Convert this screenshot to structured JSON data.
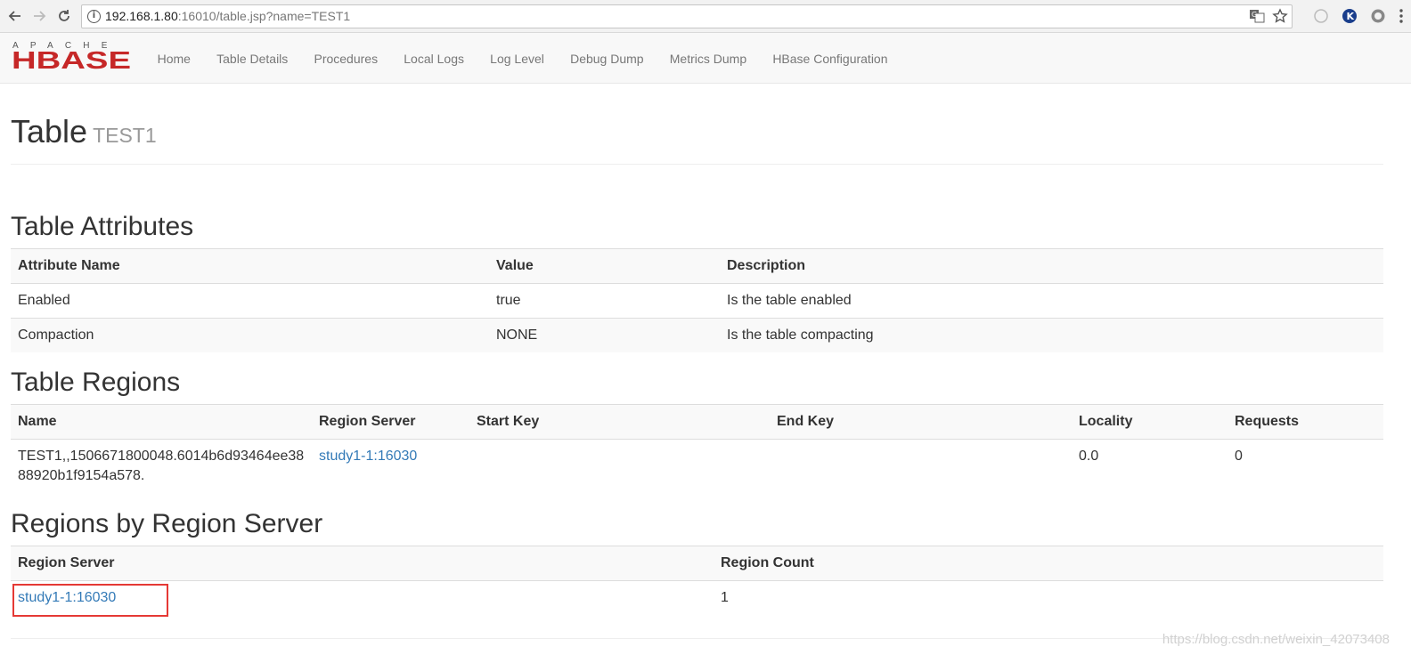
{
  "browser": {
    "url_host": "192.168.1.80",
    "url_rest": ":16010/table.jsp?name=TEST1"
  },
  "logo": {
    "top_text": "APACHE",
    "main_text": "HBASE",
    "brand_color": "#c62828"
  },
  "nav": {
    "items": [
      "Home",
      "Table Details",
      "Procedures",
      "Local Logs",
      "Log Level",
      "Debug Dump",
      "Metrics Dump",
      "HBase Configuration"
    ]
  },
  "header": {
    "title": "Table",
    "subtitle": "TEST1"
  },
  "attributes": {
    "heading": "Table Attributes",
    "columns": [
      "Attribute Name",
      "Value",
      "Description"
    ],
    "rows": [
      [
        "Enabled",
        "true",
        "Is the table enabled"
      ],
      [
        "Compaction",
        "NONE",
        "Is the table compacting"
      ]
    ]
  },
  "regions": {
    "heading": "Table Regions",
    "columns": [
      "Name",
      "Region Server",
      "Start Key",
      "End Key",
      "Locality",
      "Requests"
    ],
    "rows": [
      {
        "name_line1": "TEST1,,1506671800048.6014b6d93464ee38",
        "name_line2": "88920b1f9154a578.",
        "server": "study1-1:16030",
        "start_key": "",
        "end_key": "",
        "locality": "0.0",
        "requests": "0"
      }
    ]
  },
  "by_server": {
    "heading": "Regions by Region Server",
    "columns": [
      "Region Server",
      "Region Count"
    ],
    "rows": [
      {
        "server": "study1-1:16030",
        "count": "1"
      }
    ]
  },
  "watermark": "https://blog.csdn.net/weixin_42073408"
}
